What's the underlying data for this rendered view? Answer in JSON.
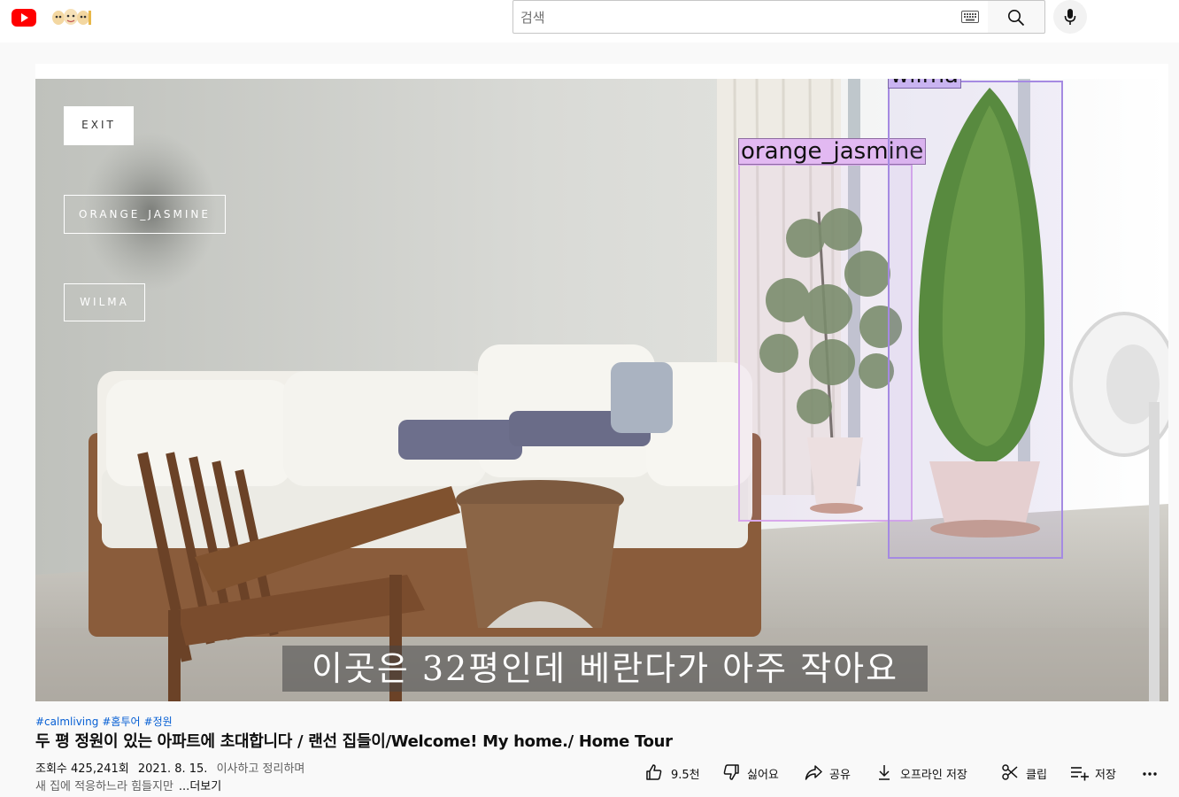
{
  "header": {
    "search_placeholder": "검색",
    "logo_icon": "youtube-logo-icon",
    "brand_color": "#ff0000"
  },
  "overlay": {
    "exit_label": "EXIT",
    "class_buttons": [
      "ORANGE_JASMINE",
      "WILMA"
    ]
  },
  "detections": [
    {
      "label": "orange_jasmine",
      "color": "#d8a8ec"
    },
    {
      "label": "wilma",
      "color": "#a58ae2"
    }
  ],
  "video": {
    "subtitle": "이곳은 32평인데 베란다가 아주 작아요"
  },
  "info": {
    "hashtags": [
      "#calmliving",
      "#홈투어",
      "#정원"
    ],
    "title": "두 평 정원이 있는 아파트에 초대합니다 / 랜선 집들이/Welcome! My home./ Home Tour",
    "views": "조회수 425,241회",
    "date": "2021. 8. 15.",
    "description_line1": "이사하고 정리하며",
    "description_line2": "새 집에 적응하느라 힘들지만",
    "more_label": "...더보기"
  },
  "actions": {
    "like_count": "9.5천",
    "dislike_label": "싫어요",
    "share_label": "공유",
    "download_label": "오프라인 저장",
    "clip_label": "클립",
    "save_label": "저장",
    "more_icon": "more-horiz-icon"
  }
}
